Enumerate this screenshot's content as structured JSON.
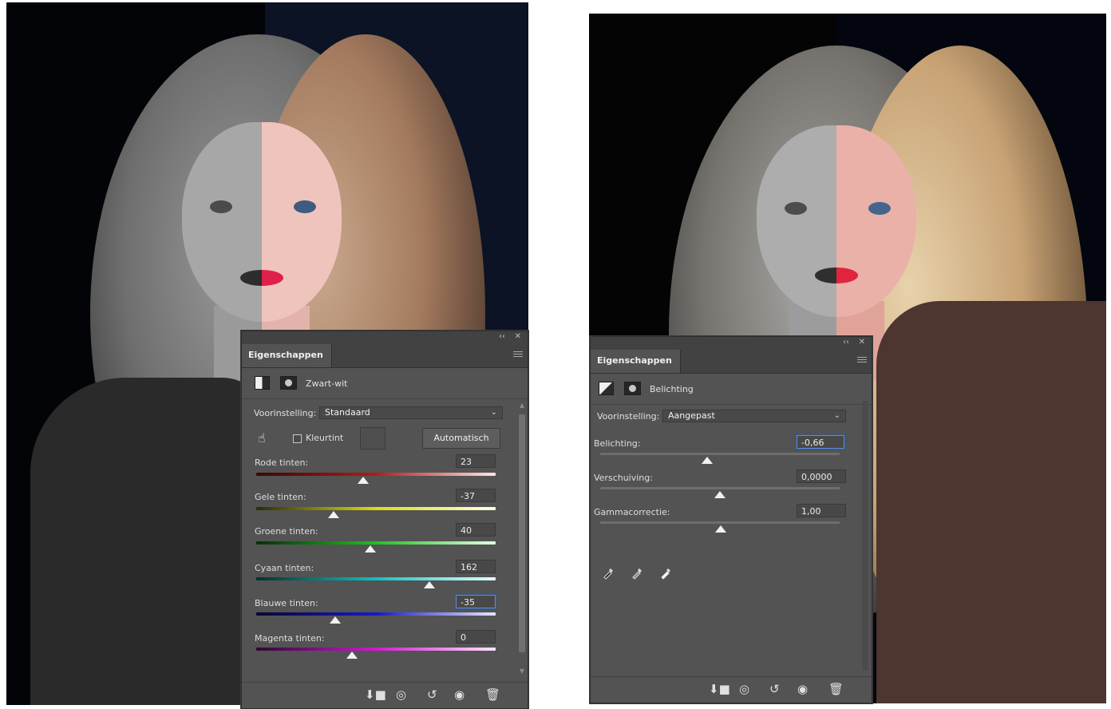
{
  "left_panel": {
    "tab_title": "Eigenschappen",
    "adjustment_name": "Zwart-wit",
    "preset_label": "Voorinstelling:",
    "preset_value": "Standaard",
    "tint_label": "Kleurtint",
    "auto_button": "Automatisch",
    "sliders": [
      {
        "label": "Rode tinten:",
        "value": "23"
      },
      {
        "label": "Gele tinten:",
        "value": "-37"
      },
      {
        "label": "Groene tinten:",
        "value": "40"
      },
      {
        "label": "Cyaan tinten:",
        "value": "162"
      },
      {
        "label": "Blauwe tinten:",
        "value": "-35"
      },
      {
        "label": "Magenta tinten:",
        "value": "0"
      }
    ]
  },
  "right_panel": {
    "tab_title": "Eigenschappen",
    "adjustment_name": "Belichting",
    "preset_label": "Voorinstelling:",
    "preset_value": "Aangepast",
    "sliders": [
      {
        "label": "Belichting:",
        "value": "-0,66"
      },
      {
        "label": "Verschuiving:",
        "value": "0,0000"
      },
      {
        "label": "Gammacorrectie:",
        "value": "1,00"
      }
    ]
  },
  "icons": {
    "panel_controls": [
      "collapse-icon",
      "close-icon"
    ],
    "footer": [
      "clip-to-layer-icon",
      "view-previous-icon",
      "reset-icon",
      "visibility-icon",
      "delete-icon"
    ],
    "eyedroppers": [
      "black-point-eyedropper-icon",
      "gray-point-eyedropper-icon",
      "white-point-eyedropper-icon"
    ]
  }
}
